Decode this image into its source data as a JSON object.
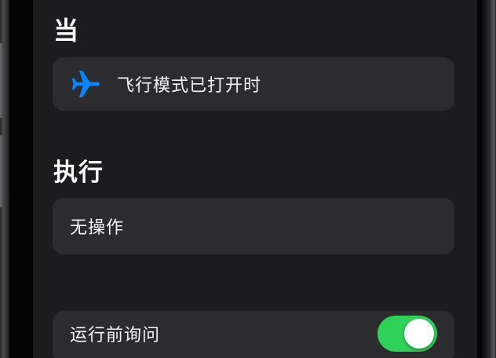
{
  "sections": {
    "when_title": "当",
    "do_title": "执行"
  },
  "trigger": {
    "icon": "airplane-icon",
    "label": "飞行模式已打开时"
  },
  "action": {
    "label": "无操作"
  },
  "ask_before_running": {
    "label": "运行前询问",
    "enabled": true
  },
  "colors": {
    "screen_bg": "#1c1c1e",
    "card_bg": "#2c2c2e",
    "accent_blue": "#0a84ff",
    "toggle_on": "#30d158",
    "text": "#f2f2f7"
  }
}
